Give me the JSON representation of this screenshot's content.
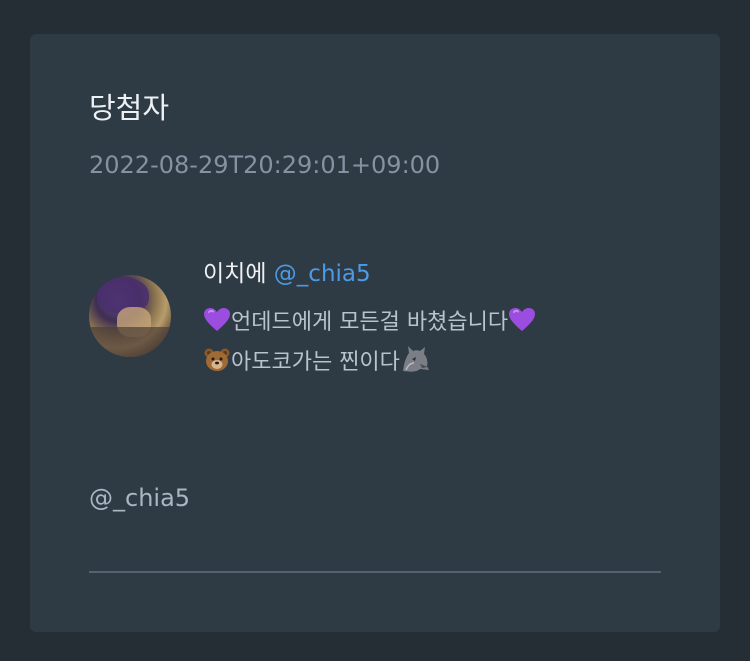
{
  "card": {
    "title": "당첨자",
    "timestamp": "2022-08-29T20:29:01+09:00"
  },
  "profile": {
    "name": "이치에",
    "handle": "@_chia5",
    "bio_line1": "언데드에게 모든걸 바쳤습니다",
    "bio_line2_text": "아도코가는 찐이다",
    "bio_icons": [
      "purple-heart-icon",
      "purple-heart-icon",
      "bear-icon",
      "wolf-icon"
    ]
  },
  "footer": {
    "handle": "@_chia5"
  },
  "colors": {
    "background": "#252d35",
    "card": "#2e3a44",
    "handle_link": "#4c9be8",
    "muted_text": "#8493a2"
  }
}
